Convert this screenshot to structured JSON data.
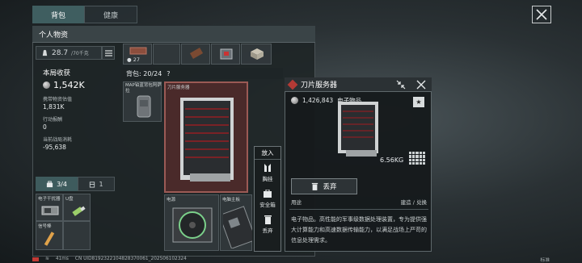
{
  "tabs": {
    "backpack": "背包",
    "health": "健康"
  },
  "panel": {
    "title": "个人物资"
  },
  "weight": {
    "current": "28.7",
    "max": "/70千克"
  },
  "stats": {
    "round_income_label": "本局收获",
    "round_income_value": "1,542K",
    "carried_value_label": "携带物资估值",
    "carried_value": "1,831K",
    "action_reward_label": "行动报酬",
    "action_reward": "0",
    "consumption_label": "当前战局消耗",
    "consumption": "-95,638"
  },
  "subtabs": {
    "backpack_count": "3/4",
    "pouch_count": "1"
  },
  "top_strip": {
    "stack_count": "27"
  },
  "backpack": {
    "label": "背包: 20/24",
    "help": "?"
  },
  "slots": {
    "map_item": "MAP铂蓝背包阿萨拉",
    "blade_server": "刀片服务器",
    "power": "电源",
    "motherboard": "电脑主板",
    "electronic_scale": "电子干扰器",
    "usb": "U盘",
    "signal_flare": "信号棒"
  },
  "context_menu": {
    "header": "放入",
    "equip": "胸挂",
    "safe_box": "安全箱",
    "discard": "丢弃"
  },
  "detail": {
    "title": "刀片服务器",
    "price": "1,426,843",
    "category": "电子物品",
    "weight": "6.56KG",
    "discard_button": "丢弃",
    "usage_label": "用途",
    "usage_value": "建造 / 兑换",
    "description": "电子物品。高性能的军事级数据处理装置，专为提供强大计算能力和高速数据传输能力，以满足战场上严苛的信息处理需求。"
  },
  "status_bar": {
    "ping": "41ms",
    "uid": "CN UID8192322104828370061_202506102324",
    "right": "标准"
  },
  "colors": {
    "accent_teal": "#3f5e60",
    "rarity_red": "#b43a35",
    "selected_border": "#9b5a55"
  }
}
